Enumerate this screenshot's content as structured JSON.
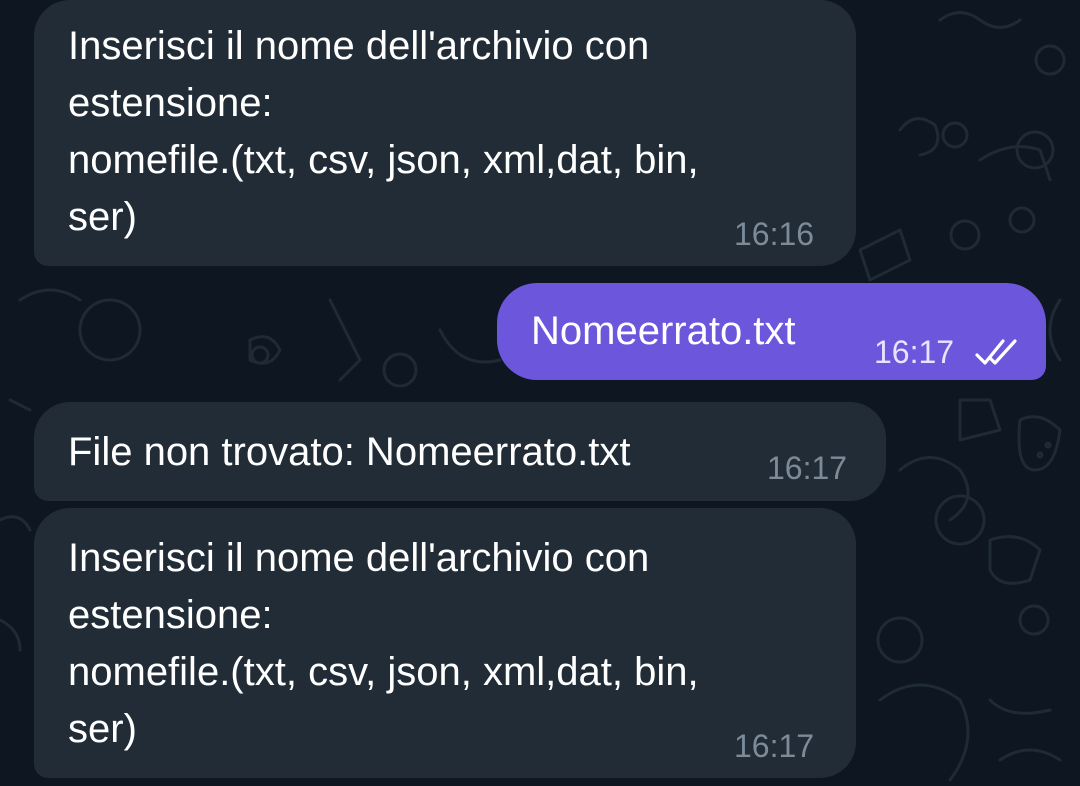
{
  "theme": {
    "background": "#0e1621",
    "incoming_bubble": "#212c36",
    "outgoing_bubble": "#6c56dc",
    "incoming_time_color": "#7d8b99",
    "outgoing_time_color": "#e8e4ff"
  },
  "messages": [
    {
      "direction": "incoming",
      "text": "Inserisci il nome dell'archivio con\nestensione:\nnomefile.(txt, csv, json, xml,dat, bin,\nser)",
      "time": "16:16"
    },
    {
      "direction": "outgoing",
      "text": "Nomeerrato.txt",
      "time": "16:17",
      "status_icon": "double-check-icon"
    },
    {
      "direction": "incoming",
      "text": "File non trovato: Nomeerrato.txt",
      "time": "16:17"
    },
    {
      "direction": "incoming",
      "text": "Inserisci il nome dell'archivio con\nestensione:\nnomefile.(txt, csv, json, xml,dat, bin,\nser)",
      "time": "16:17"
    }
  ]
}
